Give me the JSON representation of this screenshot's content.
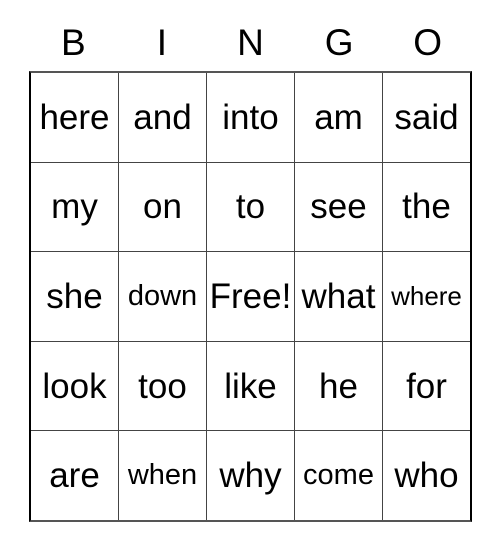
{
  "card": {
    "title": "BINGO",
    "free_space_label": "Free!",
    "columns": [
      "B",
      "I",
      "N",
      "G",
      "O"
    ],
    "rows": [
      {
        "cells": [
          {
            "text": "here",
            "size": "lg"
          },
          {
            "text": "and",
            "size": "lg"
          },
          {
            "text": "into",
            "size": "lg"
          },
          {
            "text": "am",
            "size": "lg"
          },
          {
            "text": "said",
            "size": "lg"
          }
        ]
      },
      {
        "cells": [
          {
            "text": "my",
            "size": "lg"
          },
          {
            "text": "on",
            "size": "lg"
          },
          {
            "text": "to",
            "size": "lg"
          },
          {
            "text": "see",
            "size": "lg"
          },
          {
            "text": "the",
            "size": "lg"
          }
        ]
      },
      {
        "cells": [
          {
            "text": "she",
            "size": "lg"
          },
          {
            "text": "down",
            "size": "sm"
          },
          {
            "text": "Free!",
            "size": "lg"
          },
          {
            "text": "what",
            "size": "lg"
          },
          {
            "text": "where",
            "size": "xs"
          }
        ]
      },
      {
        "cells": [
          {
            "text": "look",
            "size": "lg"
          },
          {
            "text": "too",
            "size": "lg"
          },
          {
            "text": "like",
            "size": "lg"
          },
          {
            "text": "he",
            "size": "lg"
          },
          {
            "text": "for",
            "size": "lg"
          }
        ]
      },
      {
        "cells": [
          {
            "text": "are",
            "size": "lg"
          },
          {
            "text": "when",
            "size": "sm"
          },
          {
            "text": "why",
            "size": "lg"
          },
          {
            "text": "come",
            "size": "sm"
          },
          {
            "text": "who",
            "size": "lg"
          }
        ]
      }
    ]
  },
  "colors": {
    "background": "#ffffff",
    "text": "#000000",
    "grid_line": "#444444",
    "grid_outer": "#555555"
  }
}
